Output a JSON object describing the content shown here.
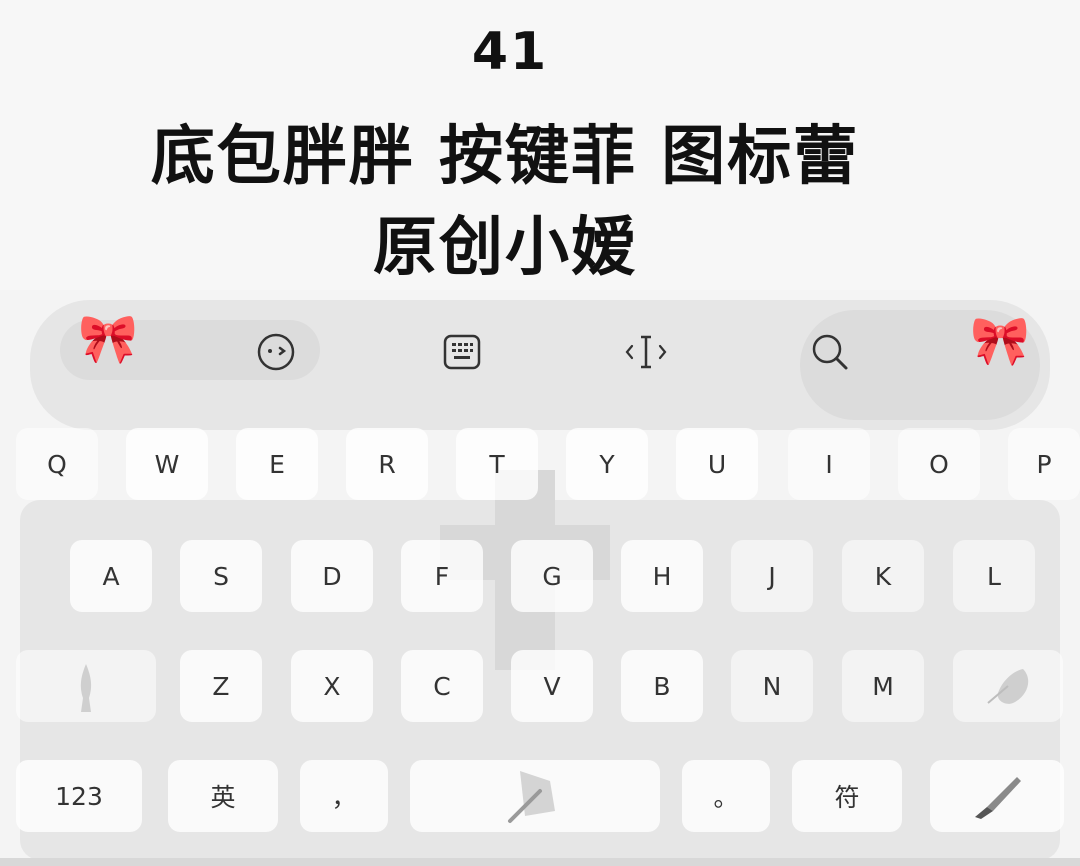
{
  "header": {
    "number": "41",
    "line1": "底包胖胖 按键菲 图标蕾",
    "line2": "原创小嫒"
  },
  "toolbar": {
    "icons": [
      "emoji-face-icon",
      "keyboard-icon",
      "text-cursor-icon",
      "search-icon"
    ]
  },
  "keyboard": {
    "row1": [
      "Q",
      "W",
      "E",
      "R",
      "T",
      "Y",
      "U",
      "I",
      "O",
      "P"
    ],
    "row2": [
      "A",
      "S",
      "D",
      "F",
      "G",
      "H",
      "J",
      "K",
      "L"
    ],
    "row3": [
      "Z",
      "X",
      "C",
      "V",
      "B",
      "N",
      "M"
    ],
    "bottom": {
      "numbers_label": "123",
      "lang_label": "英",
      "comma_label": "，",
      "period_label": "。",
      "symbols_label": "符"
    }
  }
}
